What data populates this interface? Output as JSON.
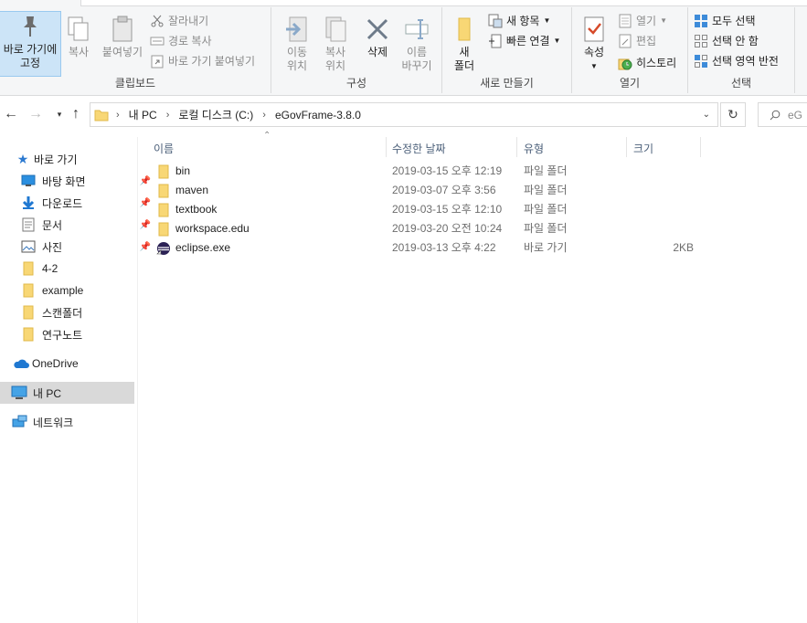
{
  "ribbon": {
    "clipboard": {
      "label": "클립보드",
      "pin_label": "바로 가기에\n고정",
      "copy_label": "복사",
      "paste_label": "붙여넣기",
      "cut_label": "잘라내기",
      "copy_path_label": "경로 복사",
      "paste_shortcut_label": "바로 가기 붙여넣기"
    },
    "organize": {
      "label": "구성",
      "move_label": "이동\n위치",
      "copy_to_label": "복사\n위치",
      "delete_label": "삭제",
      "rename_label": "이름\n바꾸기"
    },
    "new": {
      "label": "새로 만들기",
      "new_folder_label": "새\n폴더",
      "new_item_label": "새 항목",
      "easy_access_label": "빠른 연결"
    },
    "open": {
      "label": "열기",
      "properties_label": "속성",
      "open_label": "열기",
      "edit_label": "편집",
      "history_label": "히스토리"
    },
    "select": {
      "label": "선택",
      "select_all_label": "모두 선택",
      "select_none_label": "선택 안 함",
      "invert_label": "선택 영역 반전"
    }
  },
  "address": {
    "crumbs": [
      "내 PC",
      "로컬 디스크 (C:)",
      "eGovFrame-3.8.0"
    ],
    "search_placeholder": "eG"
  },
  "sidebar": {
    "items": [
      {
        "label": "바로 가기"
      },
      {
        "label": "바탕 화면"
      },
      {
        "label": "다운로드"
      },
      {
        "label": "문서"
      },
      {
        "label": "사진"
      },
      {
        "label": "4-2"
      },
      {
        "label": "example"
      },
      {
        "label": "스캔폴더"
      },
      {
        "label": "연구노트"
      },
      {
        "label": "OneDrive"
      },
      {
        "label": "내 PC"
      },
      {
        "label": "네트워크"
      }
    ]
  },
  "columns": {
    "name": "이름",
    "date": "수정한 날짜",
    "type": "유형",
    "size": "크기"
  },
  "files": [
    {
      "name": "bin",
      "date": "2019-03-15 오후 12:19",
      "type": "파일 폴더",
      "size": ""
    },
    {
      "name": "maven",
      "date": "2019-03-07 오후 3:56",
      "type": "파일 폴더",
      "size": ""
    },
    {
      "name": "textbook",
      "date": "2019-03-15 오후 12:10",
      "type": "파일 폴더",
      "size": ""
    },
    {
      "name": "workspace.edu",
      "date": "2019-03-20 오전 10:24",
      "type": "파일 폴더",
      "size": ""
    },
    {
      "name": "eclipse.exe",
      "date": "2019-03-13 오후 4:22",
      "type": "바로 가기",
      "size": "2KB"
    }
  ],
  "colors": {
    "folder": "#f8d775",
    "selected_nav": "#d9d9d9",
    "ribbon_bg": "#f5f6f7",
    "accent": "#1a73c9"
  }
}
